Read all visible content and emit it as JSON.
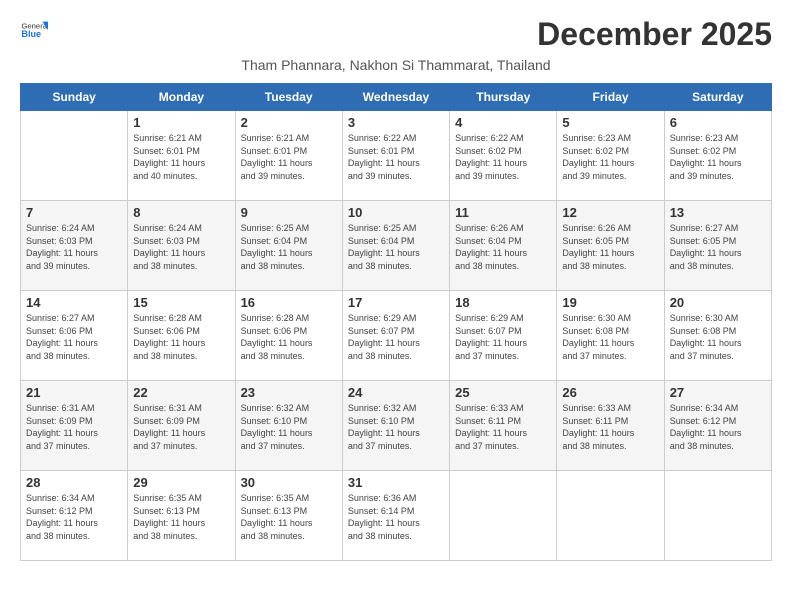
{
  "header": {
    "logo_general": "General",
    "logo_blue": "Blue",
    "month_title": "December 2025",
    "subtitle": "Tham Phannara, Nakhon Si Thammarat, Thailand"
  },
  "weekdays": [
    "Sunday",
    "Monday",
    "Tuesday",
    "Wednesday",
    "Thursday",
    "Friday",
    "Saturday"
  ],
  "weeks": [
    [
      {
        "day": "",
        "info": ""
      },
      {
        "day": "1",
        "info": "Sunrise: 6:21 AM\nSunset: 6:01 PM\nDaylight: 11 hours\nand 40 minutes."
      },
      {
        "day": "2",
        "info": "Sunrise: 6:21 AM\nSunset: 6:01 PM\nDaylight: 11 hours\nand 39 minutes."
      },
      {
        "day": "3",
        "info": "Sunrise: 6:22 AM\nSunset: 6:01 PM\nDaylight: 11 hours\nand 39 minutes."
      },
      {
        "day": "4",
        "info": "Sunrise: 6:22 AM\nSunset: 6:02 PM\nDaylight: 11 hours\nand 39 minutes."
      },
      {
        "day": "5",
        "info": "Sunrise: 6:23 AM\nSunset: 6:02 PM\nDaylight: 11 hours\nand 39 minutes."
      },
      {
        "day": "6",
        "info": "Sunrise: 6:23 AM\nSunset: 6:02 PM\nDaylight: 11 hours\nand 39 minutes."
      }
    ],
    [
      {
        "day": "7",
        "info": "Sunrise: 6:24 AM\nSunset: 6:03 PM\nDaylight: 11 hours\nand 39 minutes."
      },
      {
        "day": "8",
        "info": "Sunrise: 6:24 AM\nSunset: 6:03 PM\nDaylight: 11 hours\nand 38 minutes."
      },
      {
        "day": "9",
        "info": "Sunrise: 6:25 AM\nSunset: 6:04 PM\nDaylight: 11 hours\nand 38 minutes."
      },
      {
        "day": "10",
        "info": "Sunrise: 6:25 AM\nSunset: 6:04 PM\nDaylight: 11 hours\nand 38 minutes."
      },
      {
        "day": "11",
        "info": "Sunrise: 6:26 AM\nSunset: 6:04 PM\nDaylight: 11 hours\nand 38 minutes."
      },
      {
        "day": "12",
        "info": "Sunrise: 6:26 AM\nSunset: 6:05 PM\nDaylight: 11 hours\nand 38 minutes."
      },
      {
        "day": "13",
        "info": "Sunrise: 6:27 AM\nSunset: 6:05 PM\nDaylight: 11 hours\nand 38 minutes."
      }
    ],
    [
      {
        "day": "14",
        "info": "Sunrise: 6:27 AM\nSunset: 6:06 PM\nDaylight: 11 hours\nand 38 minutes."
      },
      {
        "day": "15",
        "info": "Sunrise: 6:28 AM\nSunset: 6:06 PM\nDaylight: 11 hours\nand 38 minutes."
      },
      {
        "day": "16",
        "info": "Sunrise: 6:28 AM\nSunset: 6:06 PM\nDaylight: 11 hours\nand 38 minutes."
      },
      {
        "day": "17",
        "info": "Sunrise: 6:29 AM\nSunset: 6:07 PM\nDaylight: 11 hours\nand 38 minutes."
      },
      {
        "day": "18",
        "info": "Sunrise: 6:29 AM\nSunset: 6:07 PM\nDaylight: 11 hours\nand 37 minutes."
      },
      {
        "day": "19",
        "info": "Sunrise: 6:30 AM\nSunset: 6:08 PM\nDaylight: 11 hours\nand 37 minutes."
      },
      {
        "day": "20",
        "info": "Sunrise: 6:30 AM\nSunset: 6:08 PM\nDaylight: 11 hours\nand 37 minutes."
      }
    ],
    [
      {
        "day": "21",
        "info": "Sunrise: 6:31 AM\nSunset: 6:09 PM\nDaylight: 11 hours\nand 37 minutes."
      },
      {
        "day": "22",
        "info": "Sunrise: 6:31 AM\nSunset: 6:09 PM\nDaylight: 11 hours\nand 37 minutes."
      },
      {
        "day": "23",
        "info": "Sunrise: 6:32 AM\nSunset: 6:10 PM\nDaylight: 11 hours\nand 37 minutes."
      },
      {
        "day": "24",
        "info": "Sunrise: 6:32 AM\nSunset: 6:10 PM\nDaylight: 11 hours\nand 37 minutes."
      },
      {
        "day": "25",
        "info": "Sunrise: 6:33 AM\nSunset: 6:11 PM\nDaylight: 11 hours\nand 37 minutes."
      },
      {
        "day": "26",
        "info": "Sunrise: 6:33 AM\nSunset: 6:11 PM\nDaylight: 11 hours\nand 38 minutes."
      },
      {
        "day": "27",
        "info": "Sunrise: 6:34 AM\nSunset: 6:12 PM\nDaylight: 11 hours\nand 38 minutes."
      }
    ],
    [
      {
        "day": "28",
        "info": "Sunrise: 6:34 AM\nSunset: 6:12 PM\nDaylight: 11 hours\nand 38 minutes."
      },
      {
        "day": "29",
        "info": "Sunrise: 6:35 AM\nSunset: 6:13 PM\nDaylight: 11 hours\nand 38 minutes."
      },
      {
        "day": "30",
        "info": "Sunrise: 6:35 AM\nSunset: 6:13 PM\nDaylight: 11 hours\nand 38 minutes."
      },
      {
        "day": "31",
        "info": "Sunrise: 6:36 AM\nSunset: 6:14 PM\nDaylight: 11 hours\nand 38 minutes."
      },
      {
        "day": "",
        "info": ""
      },
      {
        "day": "",
        "info": ""
      },
      {
        "day": "",
        "info": ""
      }
    ]
  ]
}
